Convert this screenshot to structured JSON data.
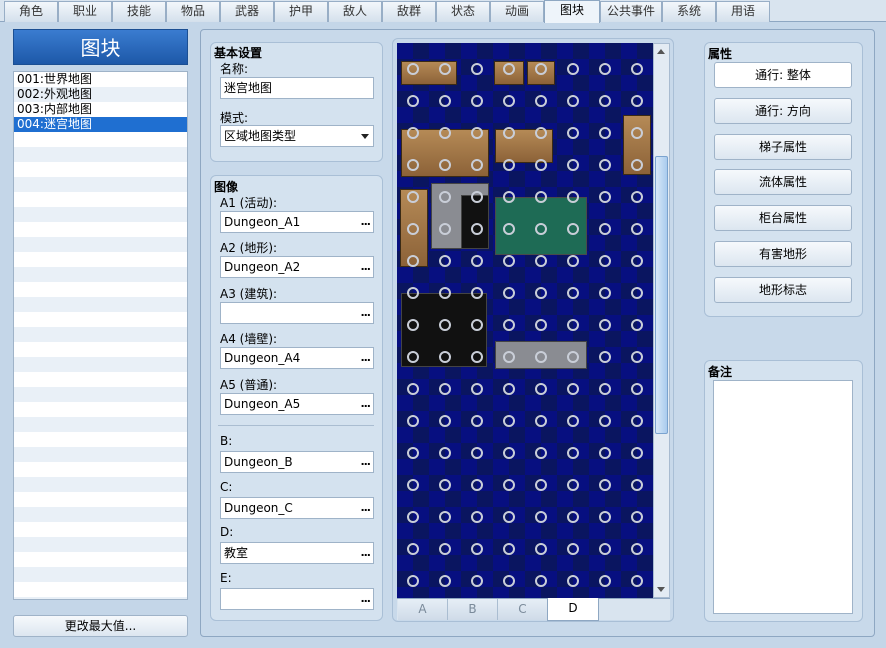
{
  "tabs": [
    "角色",
    "职业",
    "技能",
    "物品",
    "武器",
    "护甲",
    "敌人",
    "敌群",
    "状态",
    "动画",
    "图块",
    "公共事件",
    "系统",
    "用语"
  ],
  "active_tab": "图块",
  "left": {
    "header": "图块",
    "items": [
      "001:世界地图",
      "002:外观地图",
      "003:内部地图",
      "004:迷宫地图"
    ],
    "selected_index": 3,
    "change_max_button": "更改最大值..."
  },
  "basic": {
    "title": "基本设置",
    "name_label": "名称:",
    "name_value": "迷宫地图",
    "mode_label": "模式:",
    "mode_value": "区域地图类型"
  },
  "images": {
    "title": "图像",
    "a1_label": "A1 (活动):",
    "a1_value": "Dungeon_A1",
    "a2_label": "A2 (地形):",
    "a2_value": "Dungeon_A2",
    "a3_label": "A3 (建筑):",
    "a3_value": "",
    "a4_label": "A4 (墙壁):",
    "a4_value": "Dungeon_A4",
    "a5_label": "A5 (普通):",
    "a5_value": "Dungeon_A5",
    "b_label": "B:",
    "b_value": "Dungeon_B",
    "c_label": "C:",
    "c_value": "Dungeon_C",
    "d_label": "D:",
    "d_value": "教室",
    "e_label": "E:",
    "e_value": "",
    "browse_icon": "..."
  },
  "tileset_tabs": [
    "A",
    "B",
    "C",
    "D"
  ],
  "active_tileset_tab": "D",
  "properties": {
    "title": "属性",
    "buttons": [
      "通行: 整体",
      "通行: 方向",
      "梯子属性",
      "流体属性",
      "柜台属性",
      "有害地形",
      "地形标志"
    ]
  },
  "notes": {
    "title": "备注",
    "value": ""
  },
  "colors": {
    "accent": "#1f6fd1",
    "tile_bg": "#070f80"
  }
}
